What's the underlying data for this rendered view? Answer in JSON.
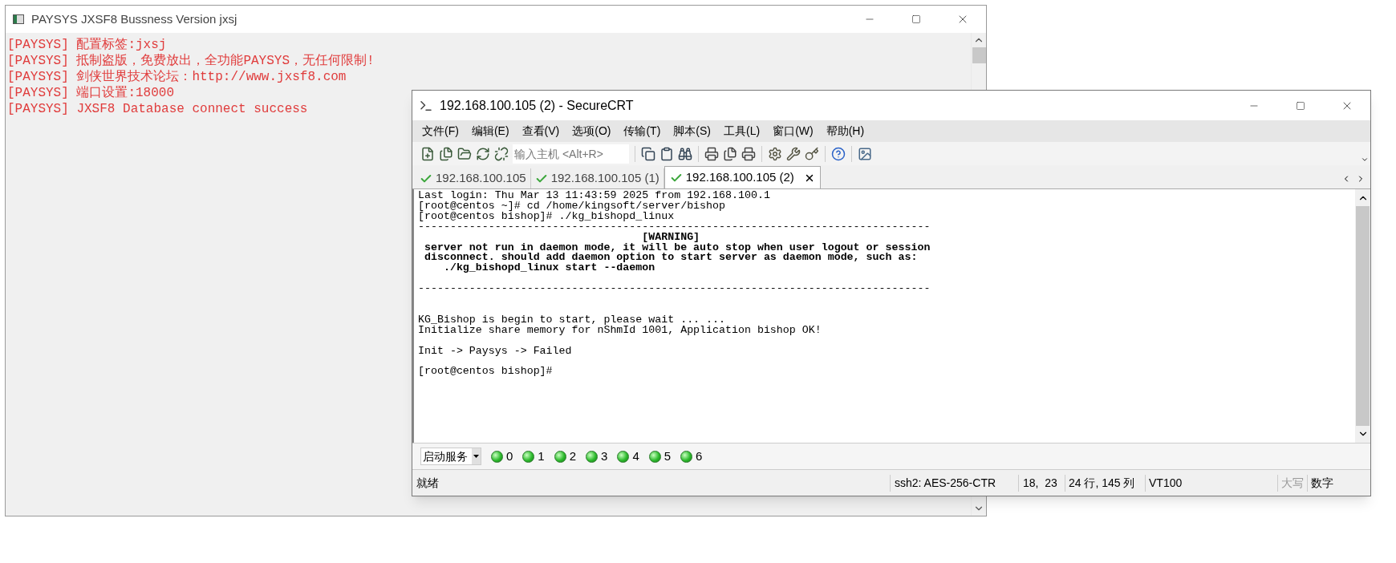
{
  "paysys_window": {
    "title": "PAYSYS JXSF8 Bussness Version jxsj",
    "log_lines": [
      "[PAYSYS] 配置标签:jxsj",
      "[PAYSYS] 抵制盗版，免费放出，全功能PAYSYS，无任何限制!",
      "[PAYSYS] 剑侠世界技术论坛：http://www.jxsf8.com",
      "[PAYSYS] 端口设置:18000",
      "[PAYSYS] JXSF8 Database connect success"
    ]
  },
  "securecrt_window": {
    "title": "192.168.100.105 (2) - SecureCRT",
    "menu": [
      "文件(F)",
      "编辑(E)",
      "查看(V)",
      "选项(O)",
      "传输(T)",
      "脚本(S)",
      "工具(L)",
      "窗口(W)",
      "帮助(H)"
    ],
    "host_field": {
      "placeholder": "输入主机 <Alt+R>"
    },
    "tabs": [
      {
        "label": "192.168.100.105",
        "selected": false
      },
      {
        "label": "192.168.100.105 (1)",
        "selected": false
      },
      {
        "label": "192.168.100.105 (2)",
        "selected": true
      }
    ],
    "terminal_lines": [
      {
        "kind": "normal",
        "text": "Last login: Thu Mar 13 11:43:59 2025 from 192.168.100.1"
      },
      {
        "kind": "normal",
        "text": "[root@centos ~]# cd /home/kingsoft/server/bishop"
      },
      {
        "kind": "normal",
        "text": "[root@centos bishop]# ./kg_bishopd_linux"
      },
      {
        "kind": "normal",
        "text": "--------------------------------------------------------------------------------"
      },
      {
        "kind": "bold",
        "text": "                                   [WARNING]"
      },
      {
        "kind": "bold",
        "text": " server not run in daemon mode, it will be auto stop when user logout or session"
      },
      {
        "kind": "bold",
        "text": " disconnect. should add daemon option to start server as daemon mode, such as:"
      },
      {
        "kind": "bold",
        "text": "    ./kg_bishopd_linux start --daemon"
      },
      {
        "kind": "blank"
      },
      {
        "kind": "normal",
        "text": "--------------------------------------------------------------------------------"
      },
      {
        "kind": "blank"
      },
      {
        "kind": "blank"
      },
      {
        "kind": "normal",
        "text": "KG_Bishop is begin to start, please wait ... ..."
      },
      {
        "kind": "normal",
        "text": "Initialize share memory for nShmId 1001, Application bishop OK!"
      },
      {
        "kind": "blank"
      },
      {
        "kind": "normal",
        "text": "Init -> Paysys -> Failed"
      },
      {
        "kind": "blank"
      },
      {
        "kind": "normal",
        "text": "[root@centos bishop]#"
      }
    ],
    "button_bar": {
      "dropdown": "启动服务",
      "sessions": [
        "0",
        "1",
        "2",
        "3",
        "4",
        "5",
        "6"
      ]
    },
    "status_bar": {
      "state": "就绪",
      "cipher": "ssh2: AES-256-CTR",
      "cursor": "18,  23",
      "size": "24 行, 145 列",
      "emulation": "VT100",
      "indicators": [
        {
          "text": "大写",
          "on": false
        },
        {
          "text": "数字",
          "on": true
        }
      ]
    }
  }
}
